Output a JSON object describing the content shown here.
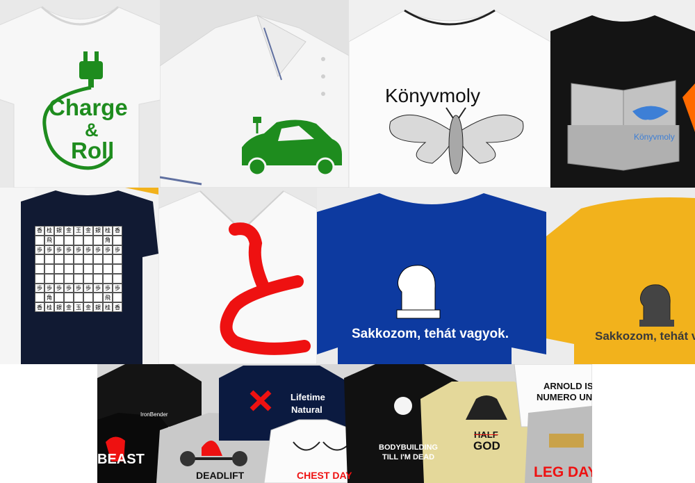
{
  "colors": {
    "green": "#1e8c1e",
    "red": "#ee1111",
    "navy_shirt": "#0d3aa0",
    "gold_shirt": "#f2b21c",
    "black_shirt": "#141414",
    "white_shirt": "#f3f3f3"
  },
  "row1": {
    "charge": {
      "line1": "Charge",
      "line2": "&",
      "line3": "Roll"
    },
    "moth": {
      "title": "Könyvmoly"
    },
    "book": {
      "title": "Könyvmoly"
    }
  },
  "row2": {
    "shogi": {
      "rows": [
        [
          "香",
          "桂",
          "銀",
          "金",
          "王",
          "金",
          "銀",
          "桂",
          "香"
        ],
        [
          "",
          "飛",
          "",
          "",
          "",
          "",
          "",
          "角",
          ""
        ],
        [
          "歩",
          "歩",
          "歩",
          "歩",
          "歩",
          "歩",
          "歩",
          "歩",
          "歩"
        ],
        [
          "",
          "",
          "",
          "",
          "",
          "",
          "",
          "",
          ""
        ],
        [
          "",
          "",
          "",
          "",
          "",
          "",
          "",
          "",
          ""
        ],
        [
          "",
          "",
          "",
          "",
          "",
          "",
          "",
          "",
          ""
        ],
        [
          "歩",
          "歩",
          "歩",
          "歩",
          "歩",
          "歩",
          "歩",
          "歩",
          "歩"
        ],
        [
          "",
          "角",
          "",
          "",
          "",
          "",
          "",
          "飛",
          ""
        ],
        [
          "香",
          "桂",
          "銀",
          "金",
          "玉",
          "金",
          "銀",
          "桂",
          "香"
        ]
      ]
    },
    "chess_navy": {
      "text": "Sakkozom, tehát vagyok."
    },
    "chess_gold": {
      "text": "Sakkozom, tehát va"
    }
  },
  "row3": {
    "ironbender": "IronBender",
    "beast": "BEAST",
    "deadlift": "DEADLIFT",
    "lifetime1": "Lifetime",
    "lifetime2": "Natural",
    "chestday": "CHEST DAY",
    "bodybuilding1": "BODYBUILDING",
    "bodybuilding2": "TILL I'M DEAD",
    "half": "HALF",
    "god": "GOD",
    "arnold1": "ARNOLD IS",
    "arnold2": "NUMERO UN",
    "legday": "LEG DAY"
  }
}
